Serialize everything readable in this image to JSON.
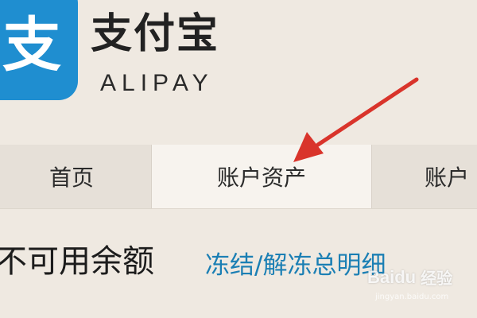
{
  "brand": {
    "logo_icon": "alipay-logo-icon",
    "glyph": "支",
    "name_cn": "支付宝",
    "name_en": "ALIPAY",
    "color": "#1f8ed0"
  },
  "nav": {
    "tabs": [
      {
        "label": "首页"
      },
      {
        "label": "账户资产"
      },
      {
        "label": "账户"
      }
    ]
  },
  "content": {
    "balance_label": "不可用余额",
    "detail_link": "冻结/解冻总明细",
    "link_color": "#1b7fb4"
  },
  "annotation": {
    "arrow_color": "#d9342b"
  },
  "watermark": {
    "text": "Baidu",
    "text_cn": "经验",
    "subtext": "jingyan.baidu.com"
  }
}
